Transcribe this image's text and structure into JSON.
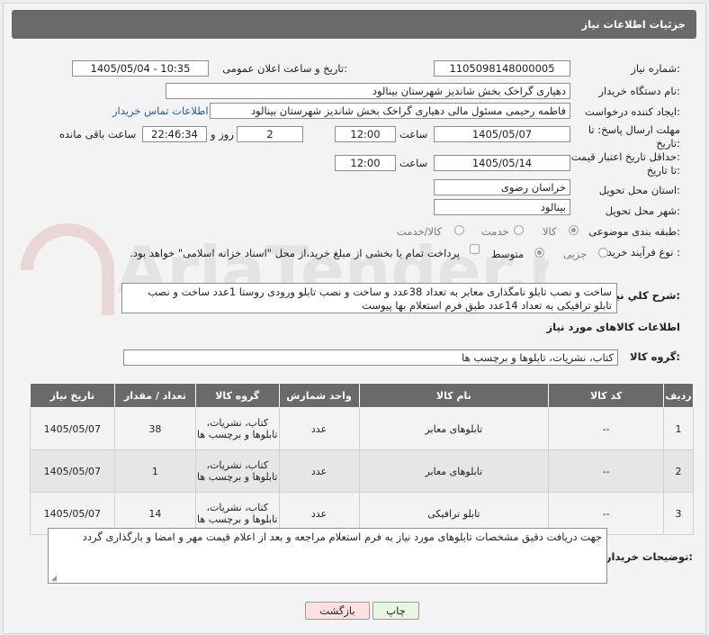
{
  "header": {
    "title": "جزئیات اطلاعات نیاز"
  },
  "fields": {
    "need_number_label": "شماره نیاز:",
    "need_number": "1105098148000005",
    "announce_label": "تاریخ و ساعت اعلان عمومی:",
    "announce_value": "1405/05/04 - 10:35",
    "buyer_org_label": "نام دستگاه خریدار:",
    "buyer_org": "دهیاری گراخک بخش شاندیز شهرستان بینالود",
    "creator_label": "ایجاد کننده درخواست:",
    "creator": "فاطمه رحیمی مسئول مالی دهیاری گراخک بخش شاندیز شهرستان بینالود",
    "contact_link": "اطلاعات تماس خریدار",
    "deadline_label_1": "مهلت ارسال پاسخ: تا",
    "deadline_label_2": "تاریخ:",
    "deadline_date": "1405/05/07",
    "time_label": "ساعت",
    "deadline_time": "12:00",
    "days_value": "2",
    "days_label": "روز و",
    "remaining_time": "22:46:34",
    "remaining_label": "ساعت باقی مانده",
    "validity_label_1": "حداقل تاریخ اعتبار قیمت:",
    "validity_label_2": "تا تاریخ:",
    "validity_date": "1405/05/14",
    "validity_time": "12:00",
    "province_label": "استان محل تحویل:",
    "province": "خراسان رضوی",
    "city_label": "شهر محل تحویل:",
    "city": "بینالود",
    "category_label": "طبقه بندی موضوعی:",
    "category_options": [
      "کالا",
      "خدمت",
      "کالا/خدمت"
    ],
    "process_label": "نوع فرآیند خرید :",
    "process_options": [
      "جزیی",
      "متوسط"
    ],
    "payment_note": "پرداخت تمام یا بخشی از مبلغ خرید،از محل \"اسناد خزانه اسلامی\" خواهد بود."
  },
  "description": {
    "label": "شرح كلي نياز:",
    "text": "ساخت و نصب تابلو نامگذاری معابر به تعداد 38عدد و ساخت و نصب تابلو ورودی روستا 1عدد ساخت و نصب تابلو ترافیکی به تعداد 14عدد طبق فرم استعلام بها پیوست"
  },
  "goods_info": {
    "title": "اطلاعات کالاهای مورد نیاز",
    "group_label": "گروه کالا:",
    "group_value": "کتاب، نشریات، تابلوها و برچسب ها"
  },
  "table": {
    "headers": [
      "ردیف",
      "کد کالا",
      "نام کالا",
      "واحد شمارش",
      "گروه کالا",
      "تعداد / مقدار",
      "تاریخ نیاز"
    ],
    "rows": [
      [
        "1",
        "--",
        "تابلوهای معابر",
        "عدد",
        "کتاب، نشریات، تابلوها و برچسب ها",
        "38",
        "1405/05/07"
      ],
      [
        "2",
        "--",
        "تابلوهای معابر",
        "عدد",
        "کتاب، نشریات، تابلوها و برچسب ها",
        "1",
        "1405/05/07"
      ],
      [
        "3",
        "--",
        "تابلو ترافیکی",
        "عدد",
        "کتاب، نشریات، تابلوها و برچسب ها",
        "14",
        "1405/05/07"
      ]
    ]
  },
  "buyer_notes": {
    "label": "توضیحات خریدار:",
    "text": "جهت دریافت دقیق مشخصات تابلوهای مورد نیاز به فرم استعلام مراجعه و بعد از اعلام قیمت مهر و امضا و بارگذاری گردد"
  },
  "buttons": {
    "print": "چاپ",
    "back": "بازگشت"
  },
  "watermark": "AriaTender.net",
  "colors": {
    "header_bg": "#6a6a6a",
    "link": "#1a5fa8",
    "back_bg": "#fde0e0",
    "print_bg": "#e7f7e0"
  }
}
